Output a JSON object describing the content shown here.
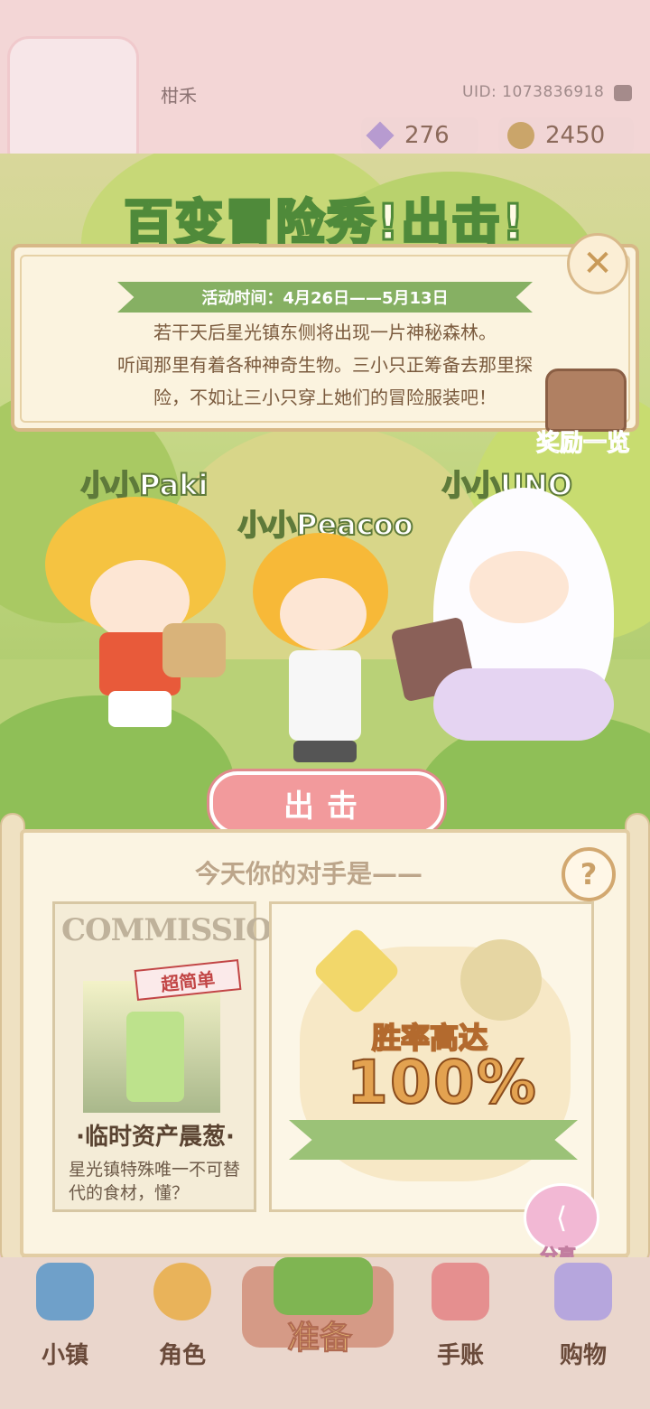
{
  "profile": {
    "username": "柑禾",
    "uid": "UID: 1073836918",
    "gems": "276",
    "coins": "2450"
  },
  "event": {
    "title": "百变冒险秀!出击!",
    "time": "活动时间：4月26日——5月13日",
    "description_lines": [
      "若干天后星光镇东侧将出现一片神秘森林。",
      "听闻那里有着各种神奇生物。三小只正筹备去那里探",
      "险，不如让三小只穿上她们的冒险服装吧！"
    ],
    "reward_label": "奖励一览"
  },
  "characters": [
    {
      "name": "小小Paki"
    },
    {
      "name": "小小Peacoo"
    },
    {
      "name": "小小UNO"
    }
  ],
  "sortie_button": "出击",
  "opponent": {
    "section_title": "今天你的对手是——",
    "card_header": "COMMISSION",
    "difficulty_stamp": "超简单",
    "name": "·临时资产晨葱·",
    "description": "星光镇特殊唯一不可替代的食材，懂？",
    "win_rate_label": "胜率高达",
    "win_rate_value": "100%",
    "share_label": "分享"
  },
  "nav": {
    "items": [
      {
        "label": "小镇",
        "icon": "map-icon"
      },
      {
        "label": "角色",
        "icon": "character-icon"
      },
      {
        "label": "准备",
        "icon": "prepare-icon",
        "active": true
      },
      {
        "label": "手账",
        "icon": "journal-icon"
      },
      {
        "label": "购物",
        "icon": "shopping-bag-icon"
      }
    ]
  },
  "colors": {
    "accent_green": "#86b063",
    "panel_bg": "#fbf3df",
    "button_pink": "#f29a9c",
    "win_rate_orange": "#e3a250"
  }
}
